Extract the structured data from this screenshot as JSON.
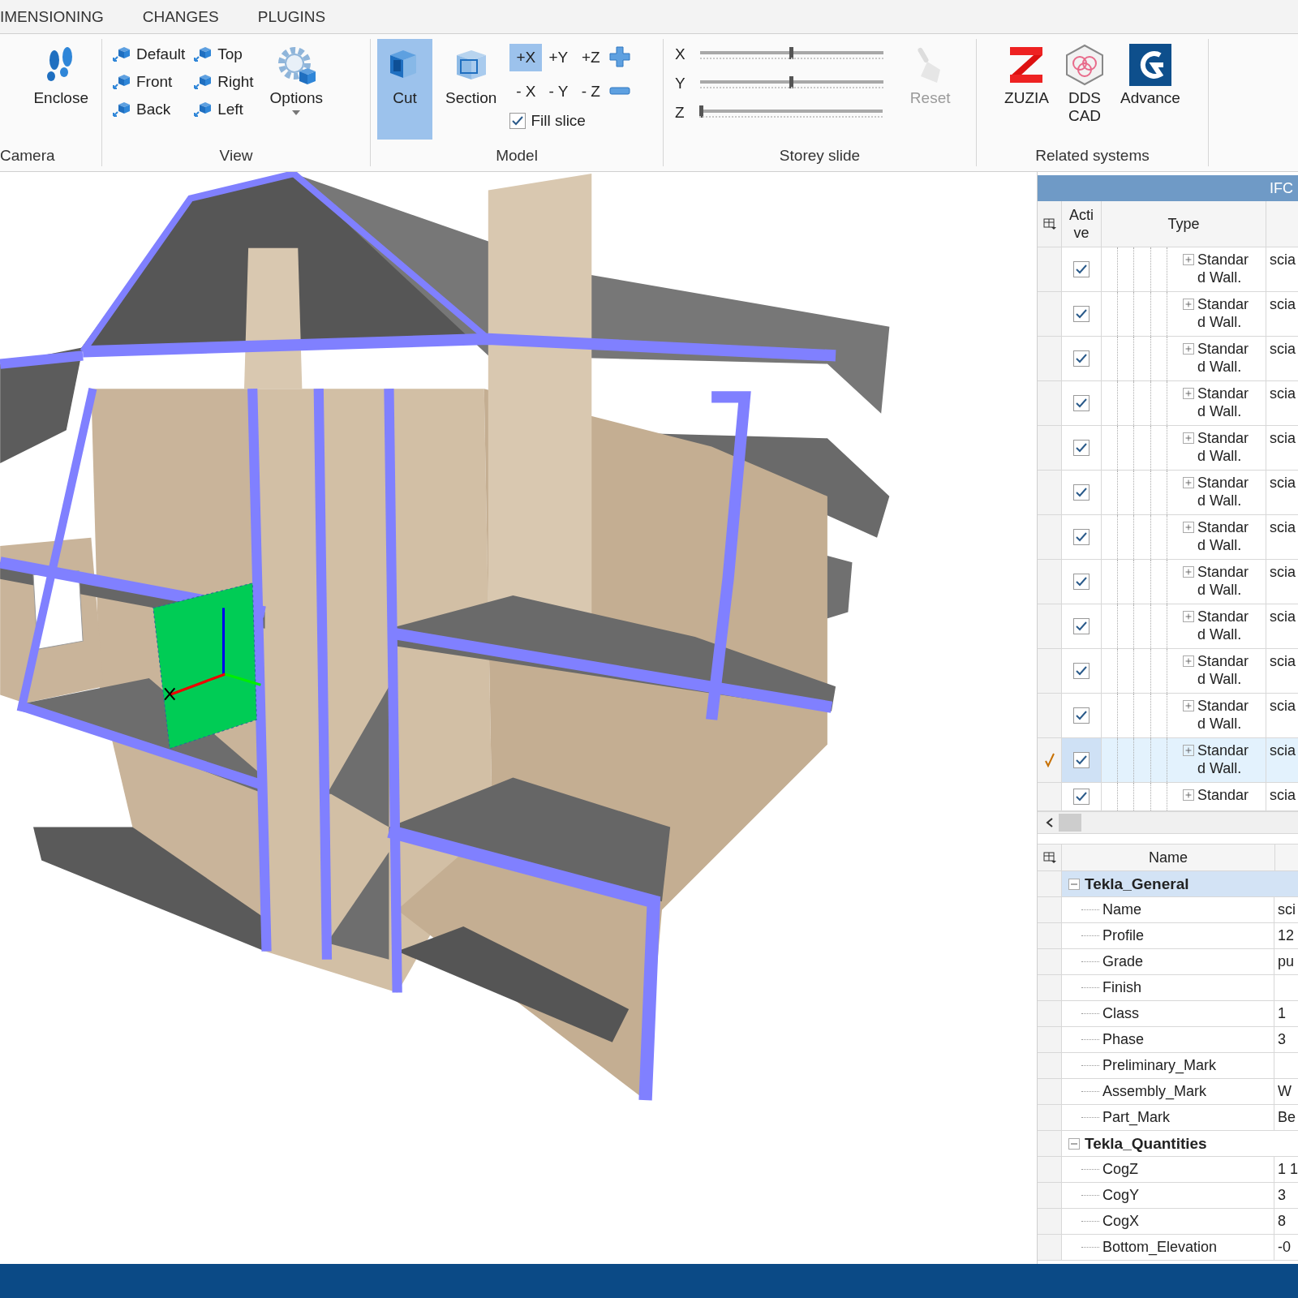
{
  "menu_tabs": [
    {
      "label": "IMENSIONING"
    },
    {
      "label": "CHANGES"
    },
    {
      "label": "PLUGINS"
    }
  ],
  "ribbon": {
    "camera": {
      "label": "Camera",
      "buttons": [
        {
          "label": "Enclose"
        }
      ]
    },
    "view": {
      "label": "View",
      "buttons": [
        {
          "label": "Default"
        },
        {
          "label": "Top"
        },
        {
          "label": "Front"
        },
        {
          "label": "Right"
        },
        {
          "label": "Back"
        },
        {
          "label": "Left"
        }
      ],
      "options": {
        "label": "Options"
      }
    },
    "model": {
      "label": "Model",
      "tools": [
        {
          "label": "Cut",
          "selected": true
        },
        {
          "label": "Section",
          "selected": false
        }
      ],
      "axes": [
        {
          "label": "+X",
          "selected": true
        },
        {
          "label": "+Y",
          "selected": false
        },
        {
          "label": "+Z",
          "selected": false
        },
        {
          "label": "- X",
          "selected": false
        },
        {
          "label": "- Y",
          "selected": false
        },
        {
          "label": "- Z",
          "selected": false
        }
      ],
      "fill_slice": {
        "label": "Fill slice",
        "checked": true
      }
    },
    "storey_slide": {
      "label": "Storey slide",
      "sliders": [
        {
          "axis": "X",
          "level": 0.5
        },
        {
          "axis": "Y",
          "level": 0.5
        },
        {
          "axis": "Z",
          "level": 0
        }
      ],
      "reset": {
        "label": "Reset",
        "disabled": true
      }
    },
    "related_systems": {
      "label": "Related systems",
      "apps": [
        {
          "label": "ZUZIA"
        },
        {
          "label": "DDS CAD"
        },
        {
          "label": "Advance"
        }
      ]
    }
  },
  "ifc_panel": {
    "title": "IFC",
    "columns": [
      "Active",
      "Type"
    ],
    "rows": [
      {
        "active": true,
        "type": "Standard Wall.",
        "column_3": "scia",
        "selected": false
      },
      {
        "active": true,
        "type": "Standard Wall.",
        "column_3": "scia",
        "selected": false
      },
      {
        "active": true,
        "type": "Standard Wall.",
        "column_3": "scia",
        "selected": false
      },
      {
        "active": true,
        "type": "Standard Wall.",
        "column_3": "scia",
        "selected": false
      },
      {
        "active": true,
        "type": "Standard Wall.",
        "column_3": "scia",
        "selected": false
      },
      {
        "active": true,
        "type": "Standard Wall.",
        "column_3": "scia",
        "selected": false
      },
      {
        "active": true,
        "type": "Standard Wall.",
        "column_3": "scia",
        "selected": false
      },
      {
        "active": true,
        "type": "Standard Wall.",
        "column_3": "scia",
        "selected": false
      },
      {
        "active": true,
        "type": "Standard Wall.",
        "column_3": "scia",
        "selected": false
      },
      {
        "active": true,
        "type": "Standard Wall.",
        "column_3": "scia",
        "selected": false
      },
      {
        "active": true,
        "type": "Standard Wall.",
        "column_3": "scia",
        "selected": false
      },
      {
        "active": true,
        "type": "Standard Wall.",
        "column_3": "scia",
        "selected": true
      },
      {
        "active": true,
        "type": "Standar",
        "column_3": "scia",
        "selected": false
      }
    ]
  },
  "properties": {
    "columns": [
      "Name"
    ],
    "groups": [
      {
        "name": "Tekla_General",
        "expanded": true,
        "selected": true,
        "children": [
          {
            "name": "Name",
            "value": "sci"
          },
          {
            "name": "Profile",
            "value": "12"
          },
          {
            "name": "Grade",
            "value": "pu"
          },
          {
            "name": "Finish"
          },
          {
            "name": "Class",
            "value": "1"
          },
          {
            "name": "Phase",
            "value": "3"
          },
          {
            "name": "Preliminary_Mark"
          },
          {
            "name": "Assembly_Mark",
            "value": "W"
          },
          {
            "name": "Part_Mark",
            "value": "Be"
          }
        ]
      },
      {
        "name": "Tekla_Quantities",
        "expanded": true,
        "selected": false,
        "children": [
          {
            "name": "CogZ",
            "value": "1 1"
          },
          {
            "name": "CogY",
            "value": "3"
          },
          {
            "name": "CogX",
            "value": "8"
          },
          {
            "name": "Bottom_Elevation",
            "value": "-0"
          }
        ]
      }
    ]
  }
}
